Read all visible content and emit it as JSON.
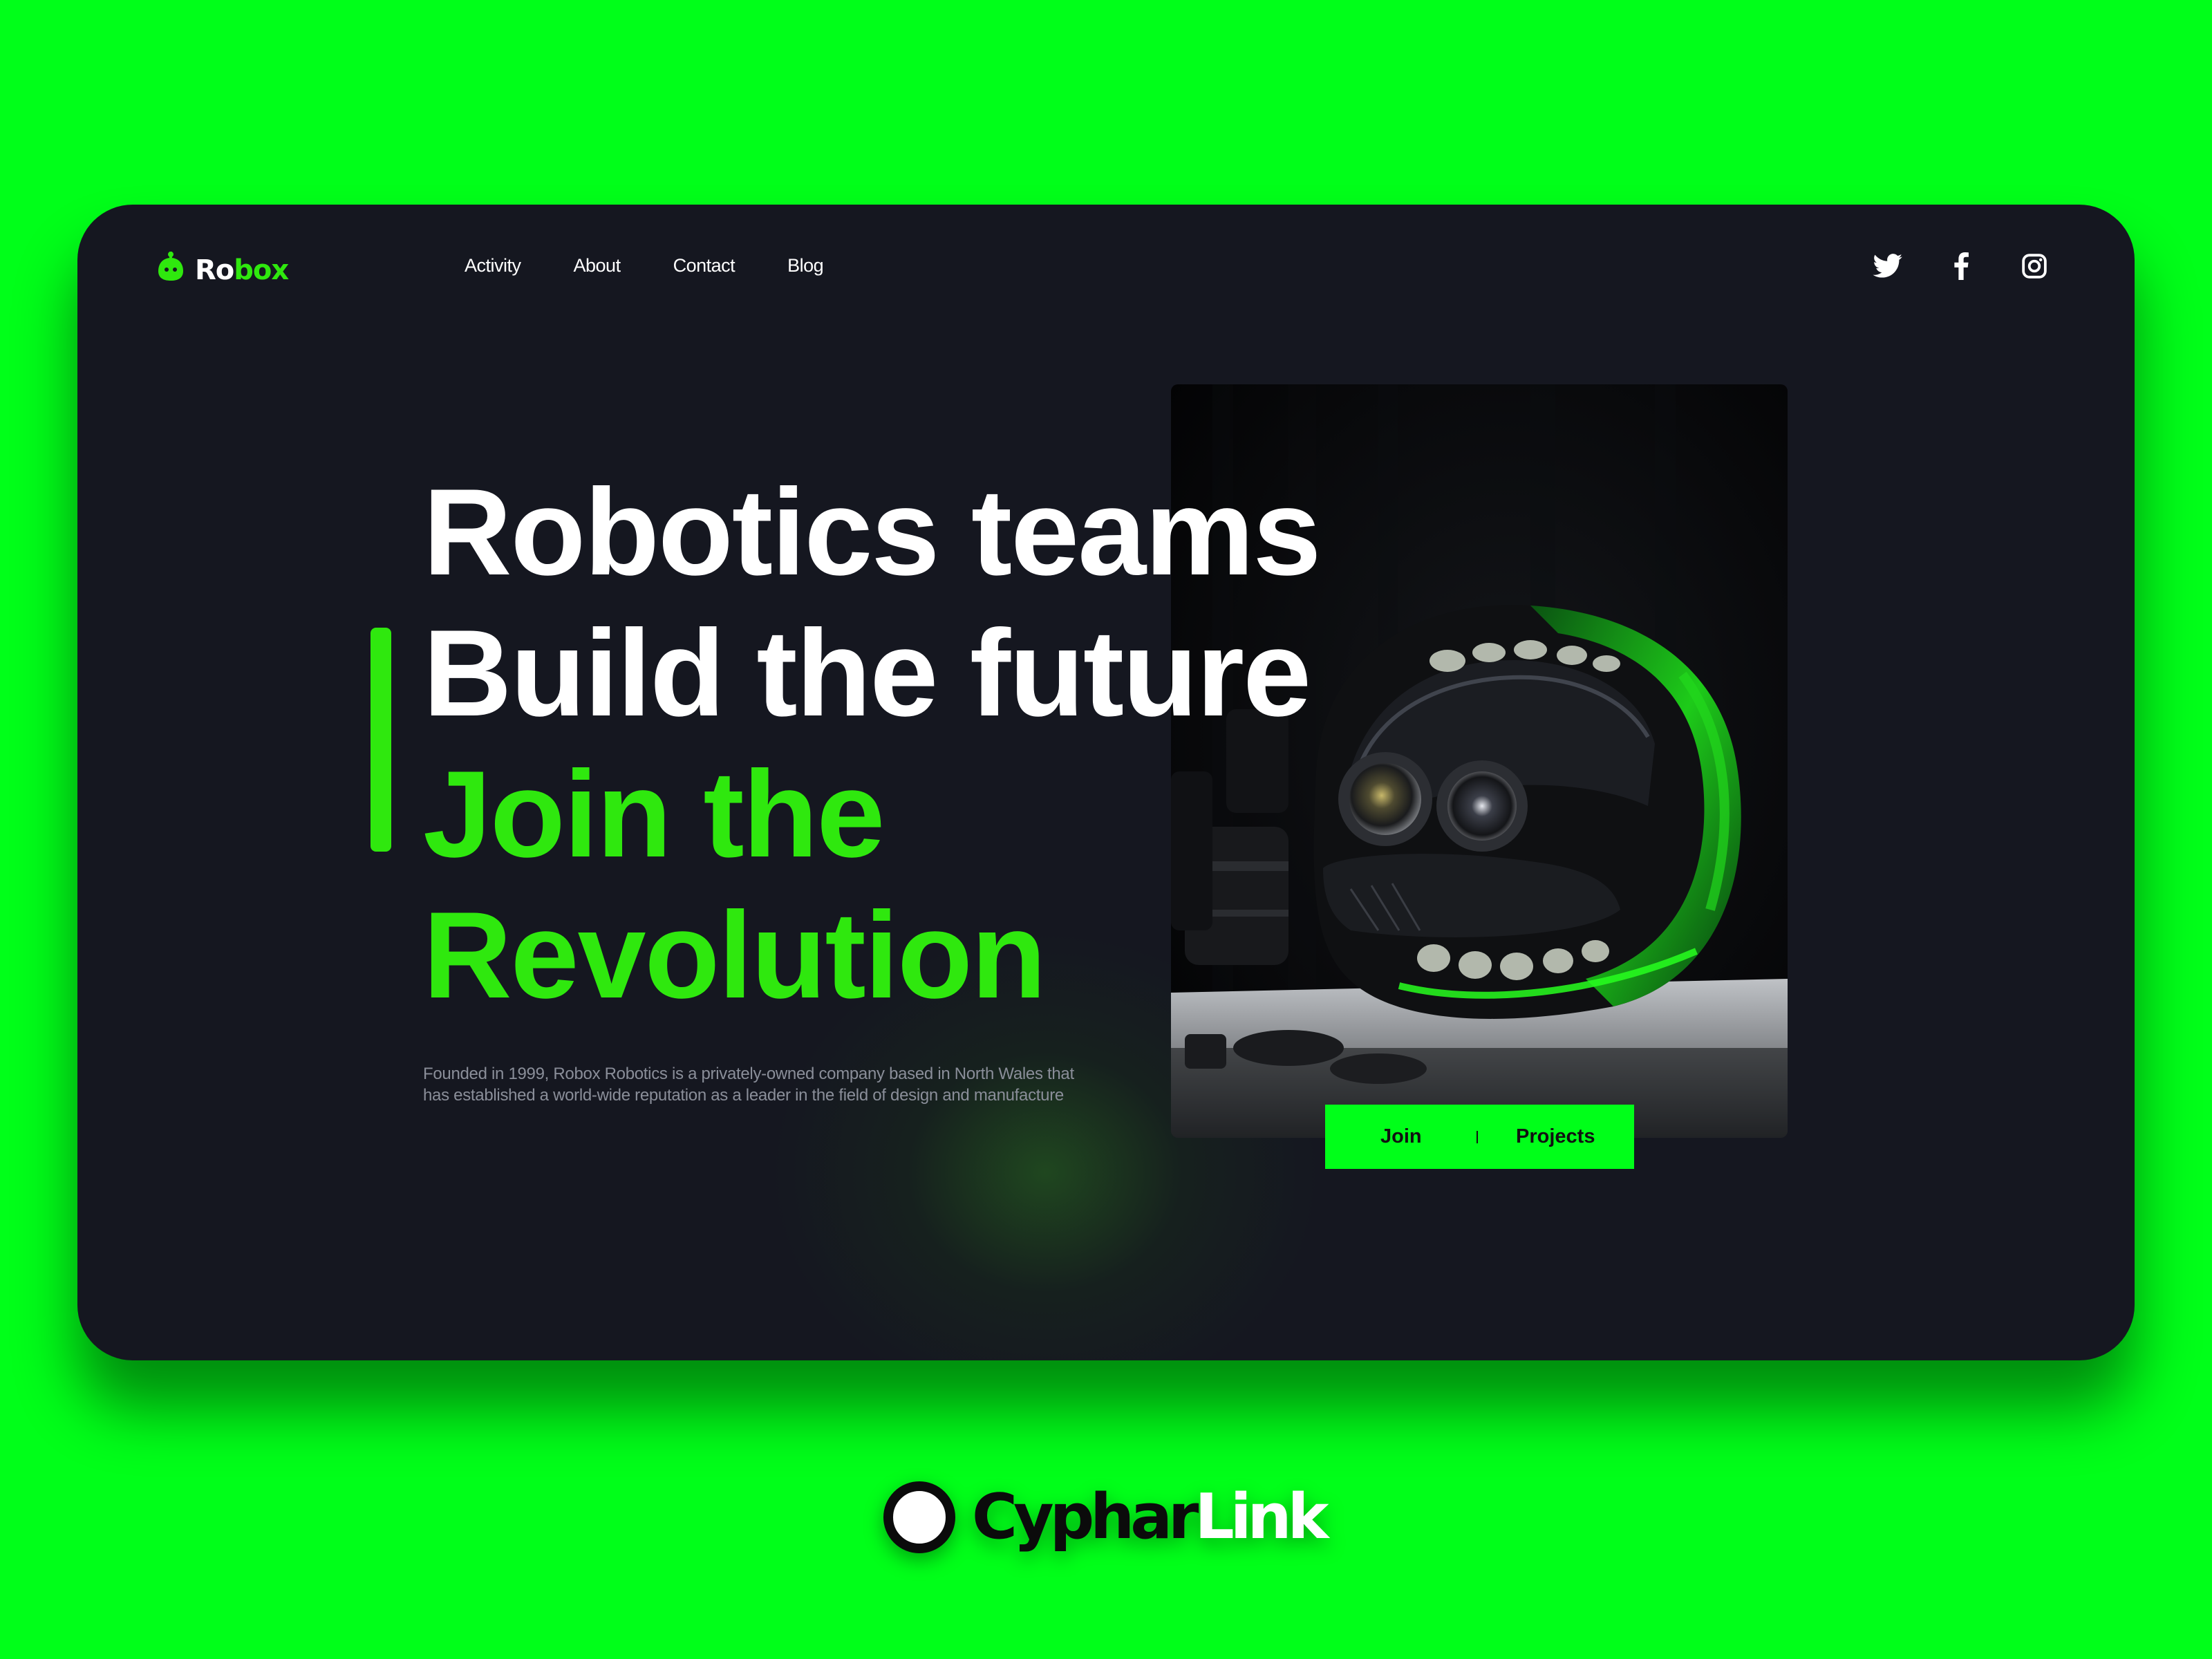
{
  "logo": {
    "part1": "Ro",
    "part2": "box"
  },
  "nav": {
    "items": [
      {
        "label": "Activity"
      },
      {
        "label": "About"
      },
      {
        "label": "Contact"
      },
      {
        "label": "Blog"
      }
    ]
  },
  "social": {
    "icons": [
      "twitter-icon",
      "facebook-icon",
      "instagram-icon"
    ]
  },
  "hero": {
    "line1": "Robotics teams",
    "line2": "Build the future",
    "line3": "Join the",
    "line4": "Revolution",
    "description": "Founded in 1999, Robox Robotics is a privately-owned company based in North Wales that has established a world-wide reputation as a leader in the field of design and manufacture",
    "cta_join": "Join",
    "cta_projects": "Projects"
  },
  "branding": {
    "part1": "Cyphar",
    "part2": "Link"
  },
  "colors": {
    "accent": "#2fe80e",
    "background": "#00ff19",
    "card": "#151720",
    "text": "#ffffff"
  }
}
